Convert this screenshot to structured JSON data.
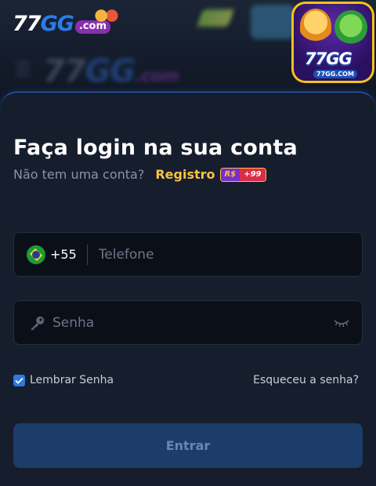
{
  "header": {
    "logo": {
      "n77": "77",
      "gg": "GG",
      "com": ".com"
    },
    "bg_logo": {
      "n77": "77",
      "gg": "GG",
      "cm": ".com"
    },
    "app_icon": {
      "label_77": "77",
      "label_gg": "GG",
      "url": "77GG.COM"
    }
  },
  "login": {
    "title": "Faça login na sua conta",
    "no_account": "Não tem uma conta?",
    "register": "Registro",
    "bonus_currency": "R$",
    "bonus_amount": "+99",
    "country_code": "+55",
    "phone_placeholder": "Telefone",
    "password_placeholder": "Senha",
    "remember_label": "Lembrar Senha",
    "remember_checked": true,
    "forgot_label": "Esqueceu a senha?",
    "submit_label": "Entrar"
  },
  "colors": {
    "accent_blue": "#2e78e0",
    "register_yellow": "#f5c243",
    "button_bg": "#1c3c6a"
  },
  "icons": [
    "flag-brazil-icon",
    "key-icon",
    "eye-closed-icon",
    "checkbox-checked-icon"
  ]
}
